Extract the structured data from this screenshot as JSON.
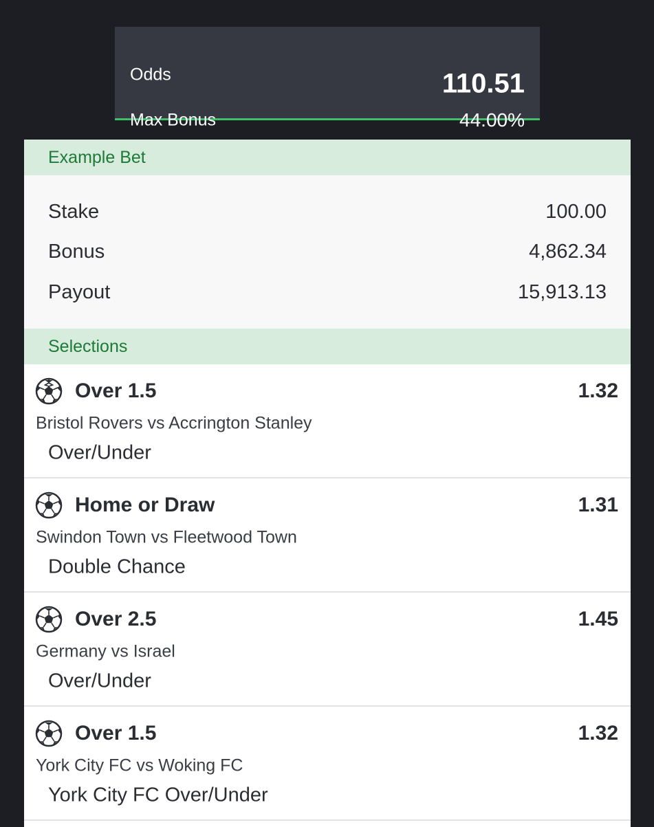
{
  "summary": {
    "odds_label": "Odds",
    "odds_value": "110.51",
    "bonus_label": "Max Bonus",
    "bonus_value": "44.00%",
    "accent": "#3fc16a"
  },
  "example_bet": {
    "title": "Example Bet",
    "stake_label": "Stake",
    "stake_value": "100.00",
    "bonus_label": "Bonus",
    "bonus_value": "4,862.34",
    "payout_label": "Payout",
    "payout_value": "15,913.13"
  },
  "selections": {
    "title": "Selections",
    "icon": "soccer-ball-icon",
    "items": [
      {
        "pick": "Over 1.5",
        "odds": "1.32",
        "match": "Bristol Rovers vs Accrington Stanley",
        "market": "Over/Under"
      },
      {
        "pick": "Home or Draw",
        "odds": "1.31",
        "match": "Swindon Town vs Fleetwood Town",
        "market": "Double Chance"
      },
      {
        "pick": "Over 2.5",
        "odds": "1.45",
        "match": "Germany vs Israel",
        "market": "Over/Under"
      },
      {
        "pick": "Over 1.5",
        "odds": "1.32",
        "match": "York City FC vs Woking FC",
        "market": "York City FC Over/Under"
      }
    ]
  }
}
